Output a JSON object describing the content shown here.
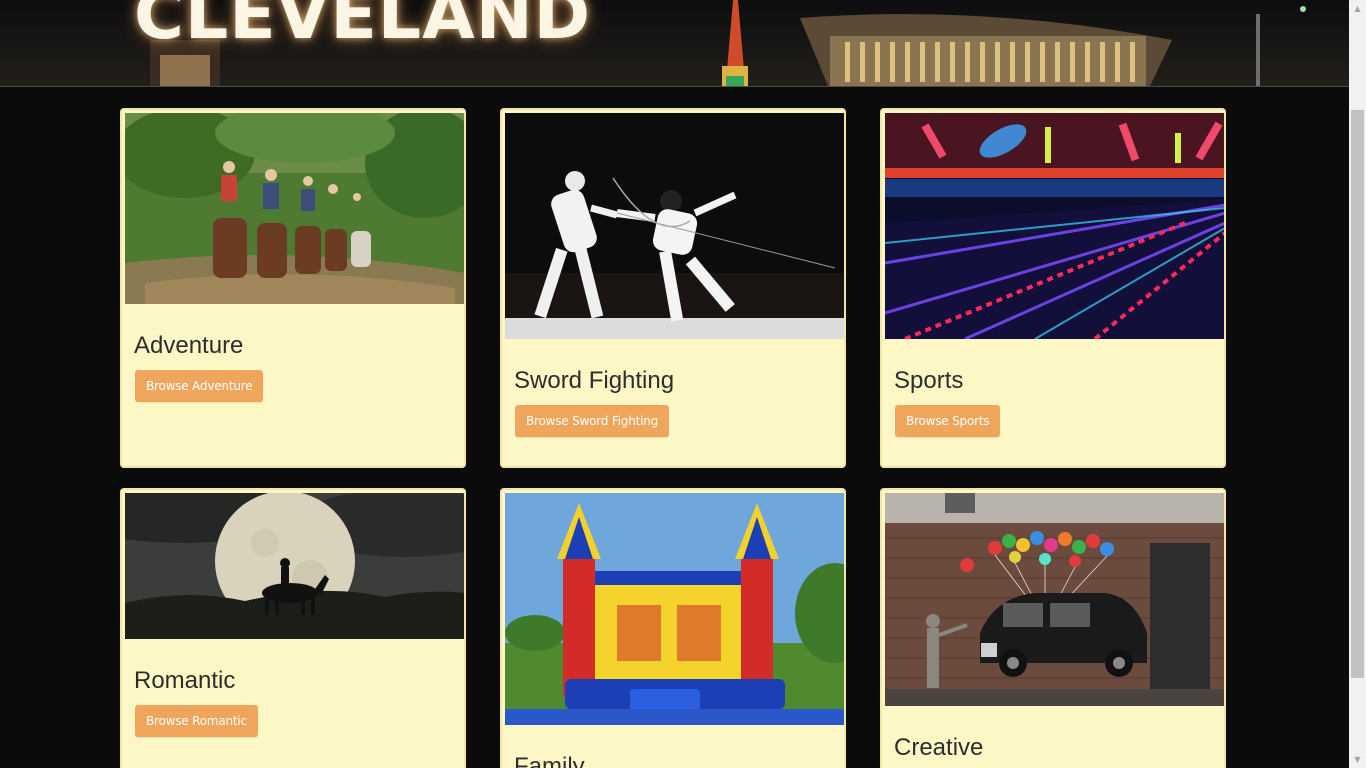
{
  "header": {
    "title": "CLEVELAND"
  },
  "categories": [
    {
      "title": "Adventure",
      "button": "Browse Adventure",
      "image": "horseback-riding-photo"
    },
    {
      "title": "Sword Fighting",
      "button": "Browse Sword Fighting",
      "image": "fencing-photo"
    },
    {
      "title": "Sports",
      "button": "Browse Sports",
      "image": "glow-bowling-photo"
    },
    {
      "title": "Romantic",
      "button": "Browse Romantic",
      "image": "moonlit-rider-photo"
    },
    {
      "title": "Family",
      "button": "",
      "image": "bounce-house-photo"
    },
    {
      "title": "Creative",
      "button": "",
      "image": "street-art-taxi-photo"
    }
  ],
  "colors": {
    "page_background": "#0b0b0b",
    "card_background": "#fdf7c5",
    "button_background": "#efa55b",
    "button_text": "#ffffff",
    "title_text": "#2d2d2d"
  }
}
